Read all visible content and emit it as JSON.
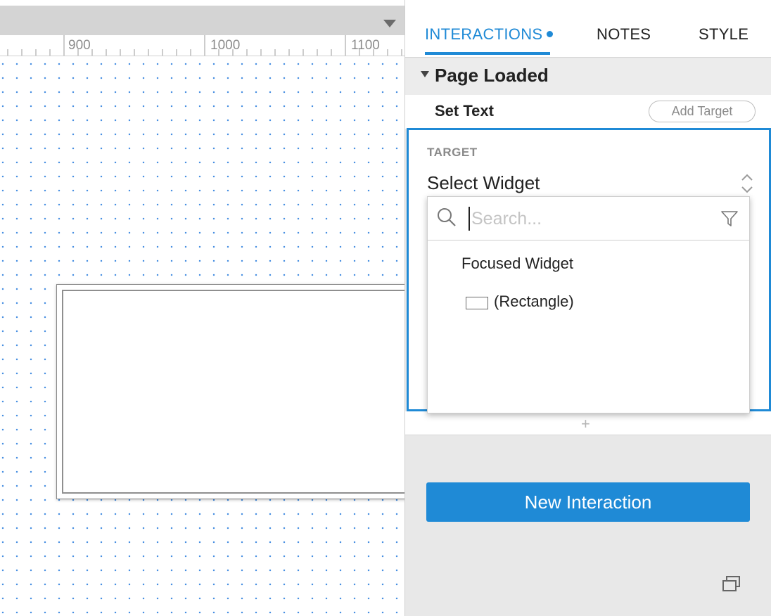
{
  "canvas": {
    "ruler_labels": [
      "900",
      "1000",
      "1100"
    ]
  },
  "panel": {
    "tabs": {
      "interactions": "INTERACTIONS",
      "notes": "NOTES",
      "style": "STYLE"
    },
    "event": {
      "title": "Page Loaded"
    },
    "action": {
      "title": "Set Text",
      "add_target_label": "Add Target"
    },
    "target": {
      "label": "TARGET",
      "select_value": "Select Widget"
    },
    "dropdown": {
      "search_placeholder": "Search...",
      "search_value": "",
      "options": [
        {
          "label": "Focused Widget"
        },
        {
          "label": "(Rectangle)",
          "icon": "rectangle-icon"
        }
      ]
    },
    "new_interaction_label": "New Interaction",
    "add_action_symbol": "+"
  },
  "colors": {
    "accent": "#1f8ad6",
    "grid_dot": "#4a90e2",
    "header_gray": "#d4d4d4"
  },
  "icons": {
    "header_dropdown": "chevron-down-icon",
    "event_caret": "caret-down-icon",
    "select_arrows": "up-down-arrows-icon",
    "search": "search-icon",
    "filter": "filter-icon",
    "popout": "popout-icon"
  }
}
